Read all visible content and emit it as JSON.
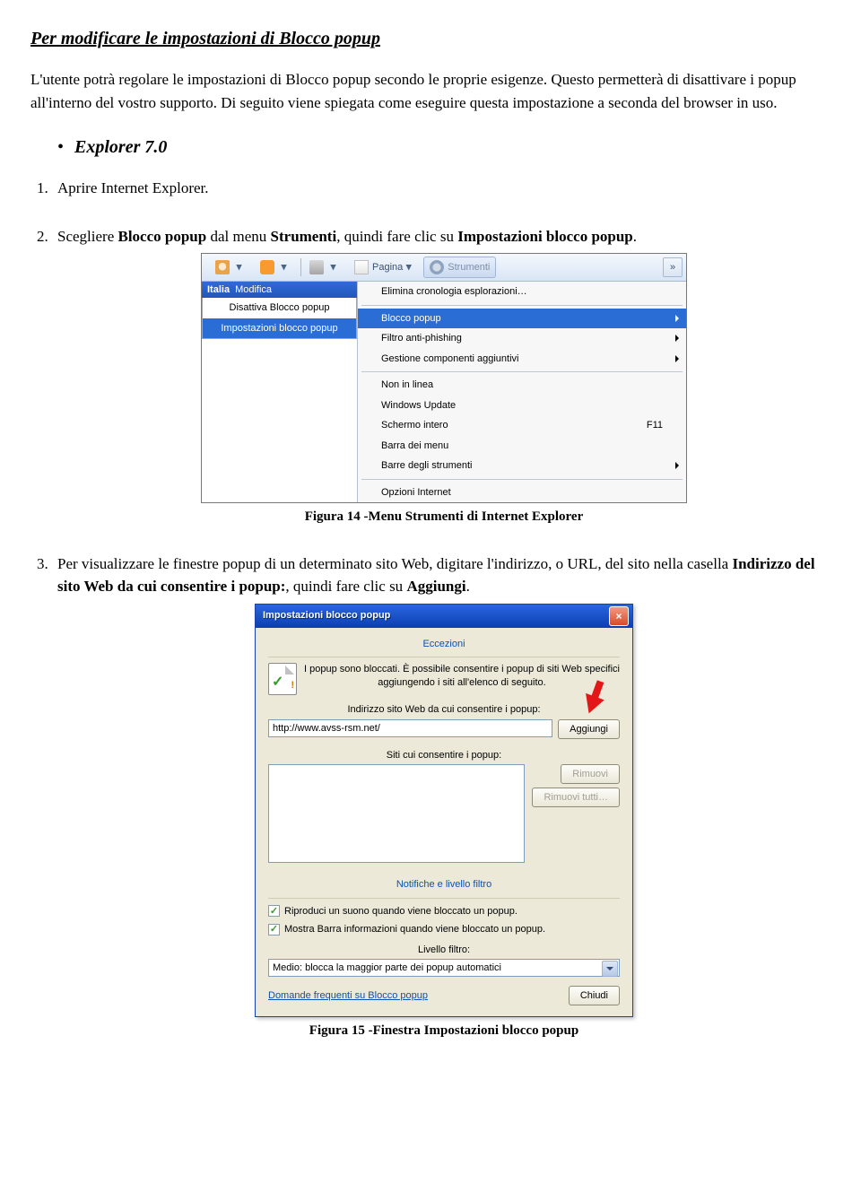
{
  "title": "Per modificare le impostazioni di Blocco popup",
  "intro": "L'utente potrà regolare le impostazioni di Blocco popup secondo le proprie esigenze. Questo permetterà di disattivare i popup all'interno del vostro supporto. Di seguito viene spiegata come eseguire questa impostazione a seconda del browser in uso.",
  "section_bullet": "Explorer 7.0",
  "steps": {
    "s1": "Aprire Internet Explorer.",
    "s2_pre": "Scegliere ",
    "s2_b1": "Blocco popup",
    "s2_mid": " dal menu ",
    "s2_b2": "Strumenti",
    "s2_mid2": ", quindi fare clic su ",
    "s2_b3": "Impostazioni blocco popup",
    "s2_end": ".",
    "s3_pre": "Per visualizzare le finestre popup di un determinato sito Web, digitare l'indirizzo, o URL, del sito nella casella ",
    "s3_b1": "Indirizzo del sito Web da cui consentire i popup:",
    "s3_mid": ", quindi fare clic su ",
    "s3_b2": "Aggiungi",
    "s3_end": "."
  },
  "fig14_caption": "Figura 14 -Menu Strumenti di Internet Explorer",
  "fig15_caption": "Figura 15 -Finestra Impostazioni blocco popup",
  "ie": {
    "pagina": "Pagina",
    "strumenti": "Strumenti",
    "italia": "Italia",
    "modifica": "Modifica",
    "flyout1": "Disattiva Blocco popup",
    "flyout2": "Impostazioni blocco popup",
    "m_cronologia": "Elimina cronologia esplorazioni…",
    "m_blocco": "Blocco popup",
    "m_filtro": "Filtro anti-phishing",
    "m_comp": "Gestione componenti aggiuntivi",
    "m_offline": "Non in linea",
    "m_wu": "Windows Update",
    "m_full": "Schermo intero",
    "m_full_sc": "F11",
    "m_barra": "Barra dei menu",
    "m_barre": "Barre degli strumenti",
    "m_opz": "Opzioni Internet"
  },
  "dlg": {
    "title": "Impostazioni blocco popup",
    "grp1": "Eccezioni",
    "info": "I popup sono bloccati. È possibile consentire i popup di siti Web specifici aggiungendo i siti all'elenco di seguito.",
    "addr_label": "Indirizzo sito Web da cui consentire i popup:",
    "addr_value": "http://www.avss-rsm.net/",
    "btn_add": "Aggiungi",
    "sites_label": "Siti cui consentire i popup:",
    "btn_remove": "Rimuovi",
    "btn_remove_all": "Rimuovi tutti…",
    "grp2": "Notifiche e livello filtro",
    "chk1": "Riproduci un suono quando viene bloccato un popup.",
    "chk2": "Mostra Barra informazioni quando viene bloccato un popup.",
    "level_label": "Livello filtro:",
    "level_value": "Medio: blocca la maggior parte dei popup automatici",
    "faq": "Domande frequenti su Blocco popup",
    "btn_close": "Chiudi"
  }
}
